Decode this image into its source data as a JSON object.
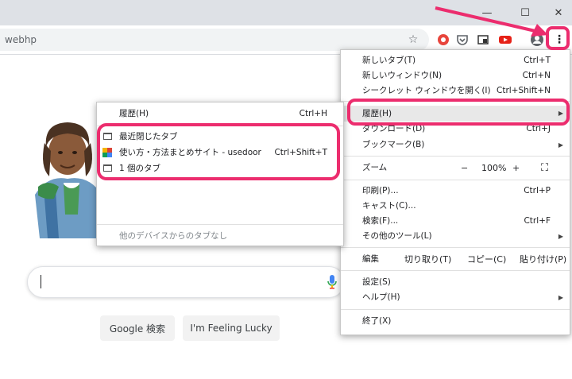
{
  "window_controls": {
    "minimize": "—",
    "maximize": "☐",
    "close": "✕"
  },
  "toolbar": {
    "url": "webhp",
    "icons": [
      "star-icon",
      "extension-red-icon",
      "pocket-icon",
      "extension-screen-icon",
      "extension-youtube-icon",
      "profile-icon",
      "menu-kebab-icon"
    ],
    "kebab": "⋮"
  },
  "page": {
    "search_btn": "Google 検索",
    "lucky_btn": "I'm Feeling Lucky"
  },
  "menu": {
    "new_tab": "新しいタブ(T)",
    "new_tab_sc": "Ctrl+T",
    "new_window": "新しいウィンドウ(N)",
    "new_window_sc": "Ctrl+N",
    "incognito": "シークレット ウィンドウを開く(I)",
    "incognito_sc": "Ctrl+Shift+N",
    "history": "履歴(H)",
    "downloads": "ダウンロード(D)",
    "downloads_sc": "Ctrl+J",
    "bookmarks": "ブックマーク(B)",
    "zoom": "ズーム",
    "zoom_minus": "−",
    "zoom_value": "100%",
    "zoom_plus": "+",
    "fullscreen": "⛶",
    "print": "印刷(P)...",
    "print_sc": "Ctrl+P",
    "cast": "キャスト(C)...",
    "find": "検索(F)...",
    "find_sc": "Ctrl+F",
    "more_tools": "その他のツール(L)",
    "edit": "編集",
    "cut": "切り取り(T)",
    "copy": "コピー(C)",
    "paste": "貼り付け(P)",
    "settings": "設定(S)",
    "help": "ヘルプ(H)",
    "exit": "終了(X)",
    "arrow": "▶"
  },
  "submenu": {
    "history": "履歴(H)",
    "history_sc": "Ctrl+H",
    "recently_closed": "最近閉じたタブ",
    "site": "使い方・方法まとめサイト - usedoor",
    "site_sc": "Ctrl+Shift+T",
    "one_tab": "1 個のタブ",
    "other_devices": "他のデバイスからのタブなし"
  },
  "colors": {
    "highlight": "#ec2d6e",
    "arrow": "#ec2d6e"
  }
}
